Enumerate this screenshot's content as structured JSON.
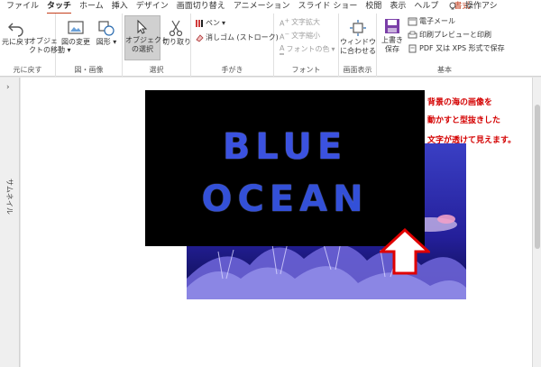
{
  "tabs": [
    "ファイル",
    "タッチ",
    "ホーム",
    "挿入",
    "デザイン",
    "画面切り替え",
    "アニメーション",
    "スライド ショー",
    "校閲",
    "表示",
    "ヘルプ"
  ],
  "format_tab": "書式",
  "search_label": "操作アシ",
  "ribbon": {
    "undo": {
      "line1": "元に戻す",
      "group": "元に戻す"
    },
    "move": {
      "line1": "オブジェ",
      "line2": "クトの移動"
    },
    "image_group": {
      "change": "図の変更",
      "shape": "図形",
      "label": "図・画像"
    },
    "select_group": {
      "select_line1": "オブジェクト",
      "select_line2": "の選択",
      "cut": "切り取り",
      "label": "選択"
    },
    "ink_group": {
      "pen": "ペン",
      "eraser": "消しゴム (ストローク)",
      "label": "手がき"
    },
    "font_group": {
      "grow": "文字拡大",
      "shrink": "文字縮小",
      "color": "フォントの色",
      "label": "フォント"
    },
    "view_group": {
      "fit_line1": "ウィンドウ",
      "fit_line2": "に合わせる",
      "label": "画面表示"
    },
    "basic_group": {
      "save_line1": "上書き",
      "save_line2": "保存",
      "email": "電子メール",
      "print": "印刷プレビューと印刷",
      "pdf": "PDF 又は XPS 形式で保存",
      "label": "基本"
    }
  },
  "thumbnail_label": "サムネイル",
  "slide": {
    "word1": "BLUE",
    "word2": "OCEAN",
    "note": [
      "背景の海の画像を",
      "動かすと型抜きした",
      "文字が透けて見えます。"
    ]
  },
  "colors": {
    "accent": "#c43e1c",
    "note": "#d40000",
    "arrow_outline": "#e00000",
    "ocean": "#1b2290"
  }
}
